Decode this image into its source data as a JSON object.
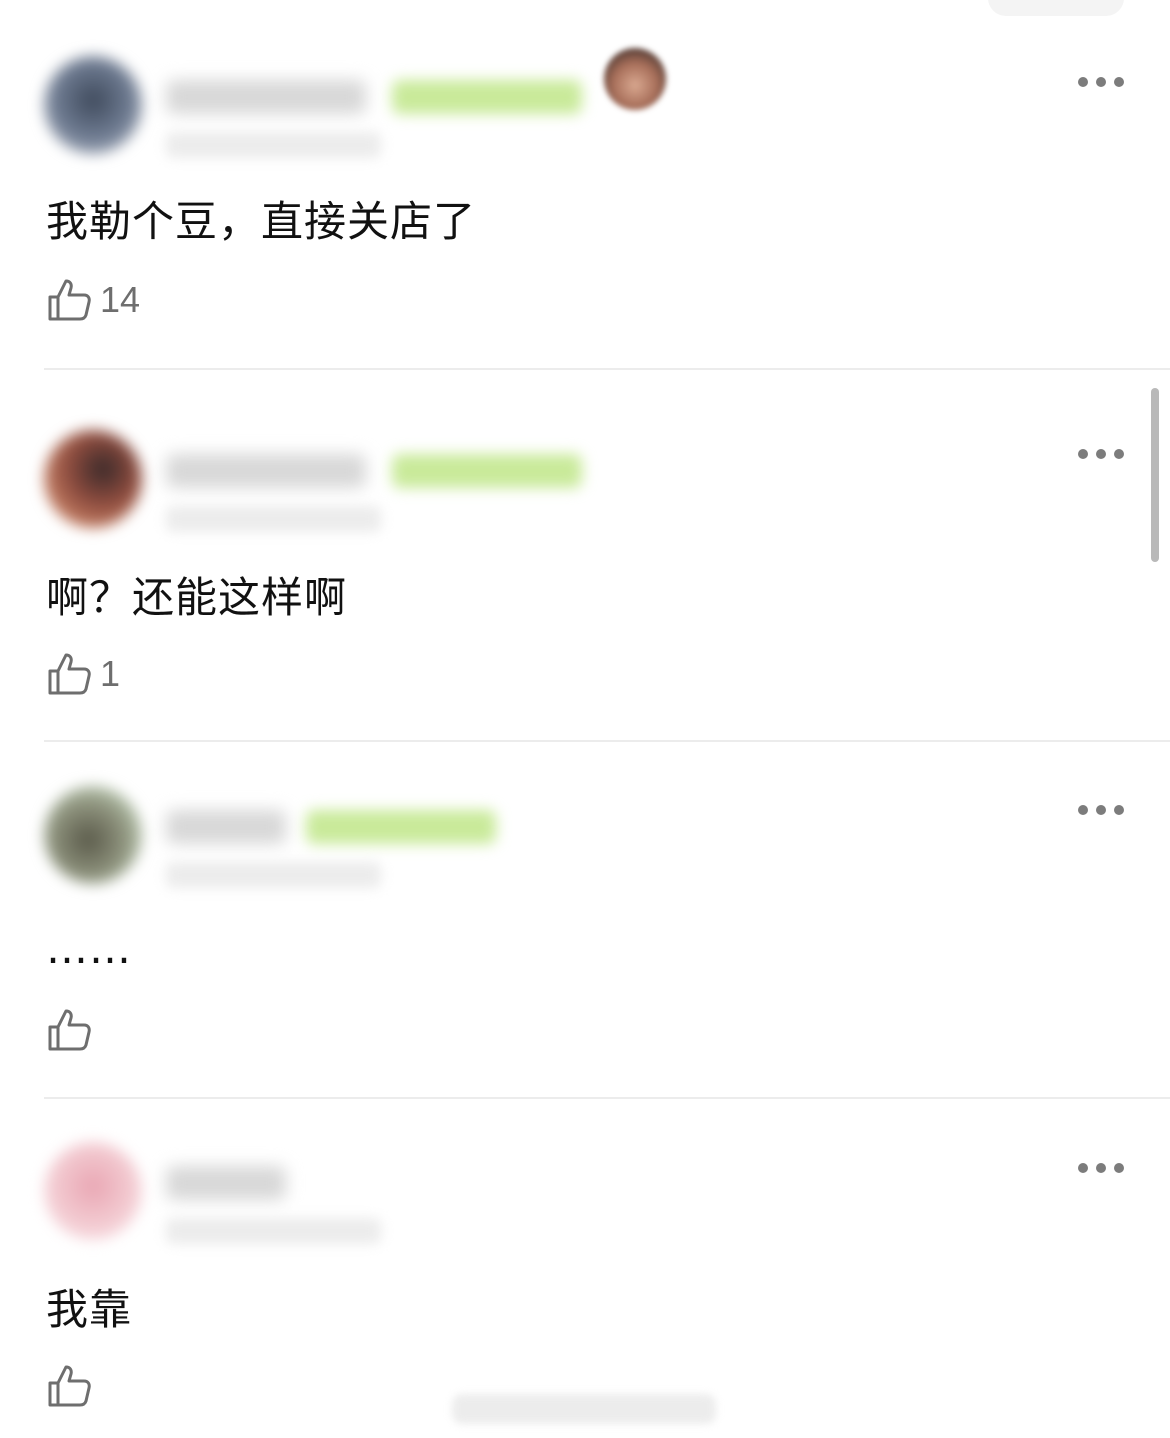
{
  "comments": [
    {
      "text": "我勒个豆，直接关店了",
      "likes": "14",
      "avatar_color": "#5f6b80",
      "badge_color": "#bfe58d",
      "like_icon": "thumbs-up-icon",
      "more_icon": "more-horizontal-icon"
    },
    {
      "text": "啊？还能这样啊",
      "likes": "1",
      "avatar_color": "#8a4a40",
      "badge_color": "#bfe58d",
      "like_icon": "thumbs-up-icon",
      "more_icon": "more-horizontal-icon"
    },
    {
      "text": "……",
      "likes": "",
      "avatar_color": "#7b7f6c",
      "badge_color": "#bfe58d",
      "like_icon": "thumbs-up-icon",
      "more_icon": "more-horizontal-icon"
    },
    {
      "text": "我靠",
      "likes": "",
      "avatar_color": "#f2c8cf",
      "like_icon": "thumbs-up-icon",
      "more_icon": "more-horizontal-icon"
    }
  ]
}
